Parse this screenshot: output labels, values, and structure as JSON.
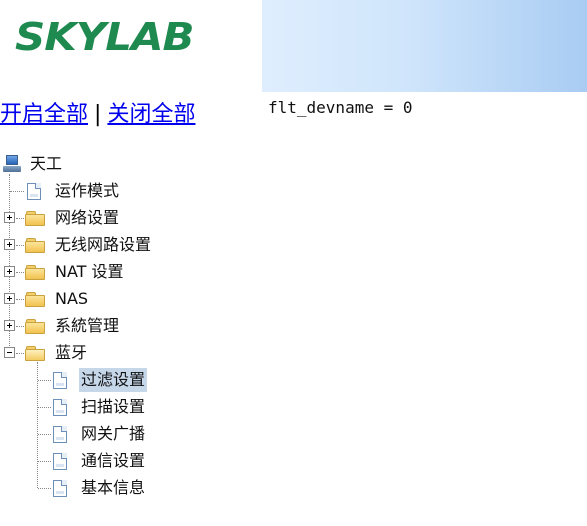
{
  "brand": {
    "logo_text": "SKYLAB",
    "logo_color": "#1f8a4f"
  },
  "banner": {
    "gradient_from": "#dfeefe",
    "gradient_to": "#a9ccf3"
  },
  "toggle": {
    "expand_all": "开启全部",
    "separator": "|",
    "collapse_all": "关闭全部"
  },
  "content": {
    "text": "flt_devname = 0"
  },
  "tree": {
    "root": {
      "label": "天工",
      "icon": "computer-icon"
    },
    "items": [
      {
        "label": "运作模式",
        "icon": "page-icon"
      },
      {
        "label": "网络设置",
        "icon": "folder-icon",
        "expanded": false
      },
      {
        "label": "无线网路设置",
        "icon": "folder-icon",
        "expanded": false
      },
      {
        "label": "NAT 设置",
        "icon": "folder-icon",
        "expanded": false
      },
      {
        "label": "NAS",
        "icon": "folder-icon",
        "expanded": false
      },
      {
        "label": "系統管理",
        "icon": "folder-icon",
        "expanded": false
      },
      {
        "label": "蓝牙",
        "icon": "folder-open-icon",
        "expanded": true,
        "children": [
          {
            "label": "过滤设置",
            "icon": "page-icon",
            "selected": true
          },
          {
            "label": "扫描设置",
            "icon": "page-icon"
          },
          {
            "label": "网关广播",
            "icon": "page-icon"
          },
          {
            "label": "通信设置",
            "icon": "page-icon"
          },
          {
            "label": "基本信息",
            "icon": "page-icon"
          }
        ]
      }
    ]
  },
  "colors": {
    "selected_bg": "#c7d7ea",
    "link": "#0000ee"
  }
}
